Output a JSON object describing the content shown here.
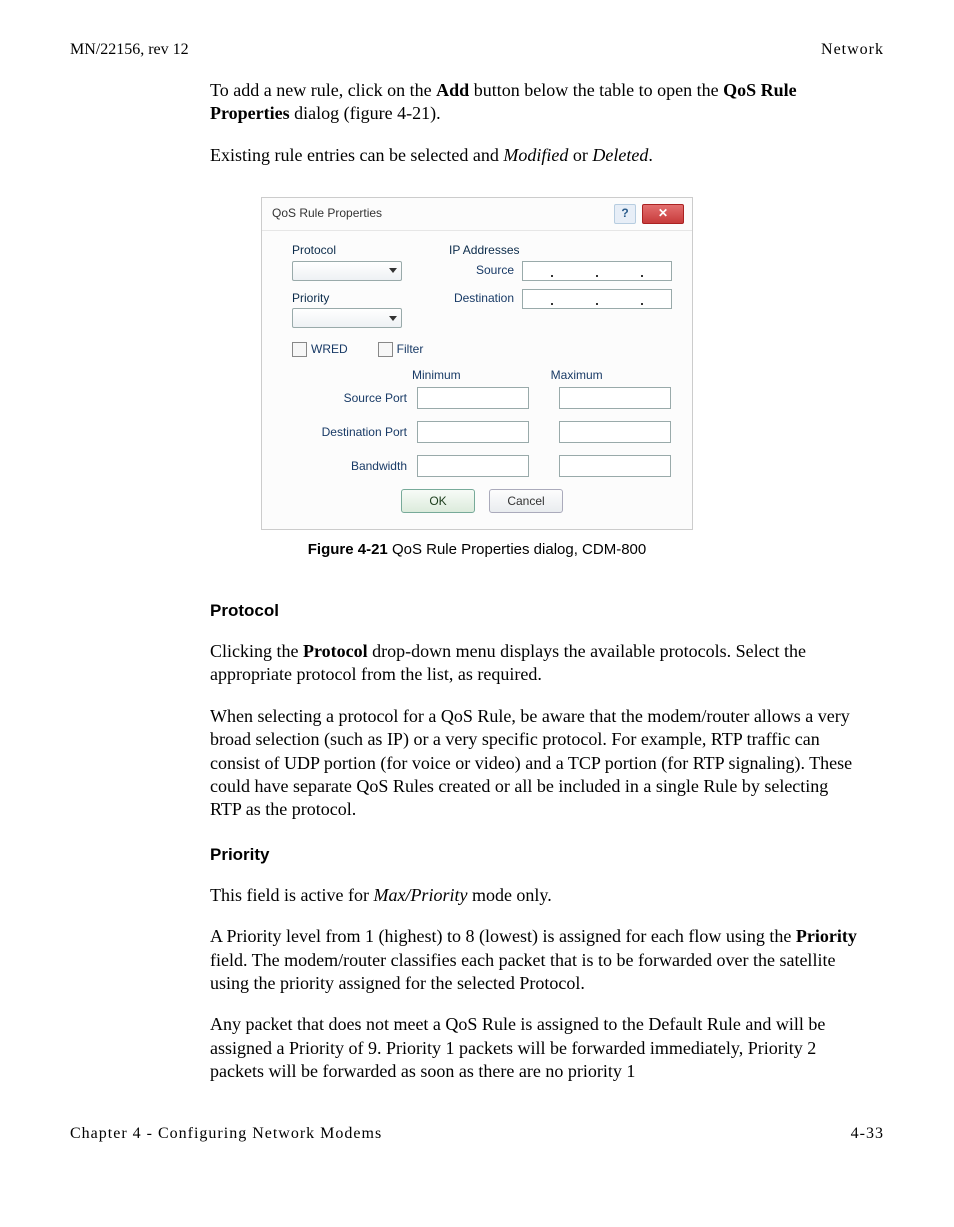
{
  "header": {
    "left": "MN/22156, rev 12",
    "right": "Network"
  },
  "intro": {
    "p1a": "To add a new rule, click on the ",
    "p1b": "Add",
    "p1c": " button below the table to open the ",
    "p1d": "QoS Rule Properties",
    "p1e": " dialog (figure 4-21).",
    "p2a": "Existing rule entries can be selected and ",
    "p2b": "Modified",
    "p2c": " or ",
    "p2d": "Deleted",
    "p2e": "."
  },
  "dialog": {
    "title": "QoS Rule Properties",
    "protocol_label": "Protocol",
    "priority_label": "Priority",
    "ip_addresses_label": "IP Addresses",
    "source_label": "Source",
    "destination_label": "Destination",
    "wred_label": "WRED",
    "filter_label": "Filter",
    "min_label": "Minimum",
    "max_label": "Maximum",
    "source_port_label": "Source Port",
    "dest_port_label": "Destination Port",
    "bandwidth_label": "Bandwidth",
    "ok": "OK",
    "cancel": "Cancel",
    "help_glyph": "?",
    "close_glyph": "✕"
  },
  "figure_caption": {
    "num": "Figure 4-21",
    "text": "  QoS Rule Properties dialog, CDM-800"
  },
  "sections": {
    "protocol": {
      "heading": "Protocol",
      "p1a": "Clicking the ",
      "p1b": "Protocol",
      "p1c": " drop-down menu displays the available protocols. Select the appropriate protocol from the list, as required.",
      "p2": "When selecting a protocol for a QoS Rule, be aware that the modem/router allows a very broad selection (such as IP) or a very specific protocol. For example, RTP traffic can consist of UDP portion (for voice or video) and a TCP portion (for RTP signaling). These could have separate QoS Rules created or all be included in a single Rule by selecting RTP as the protocol."
    },
    "priority": {
      "heading": "Priority",
      "p1a": "This field is active for ",
      "p1b": "Max/Priority",
      "p1c": " mode only.",
      "p2a": "A Priority level from 1 (highest) to 8 (lowest) is assigned for each flow using the ",
      "p2b": "Priority",
      "p2c": " field. The modem/router classifies each packet that is to be forwarded over the satellite using the priority assigned for the selected Protocol.",
      "p3": "Any packet that does not meet a QoS Rule is assigned to the Default Rule and will be assigned a Priority of 9. Priority 1 packets will be forwarded immediately, Priority 2 packets will be forwarded as soon as there are no priority 1"
    }
  },
  "footer": {
    "left": "Chapter 4 - Configuring Network Modems",
    "right": "4-33"
  }
}
